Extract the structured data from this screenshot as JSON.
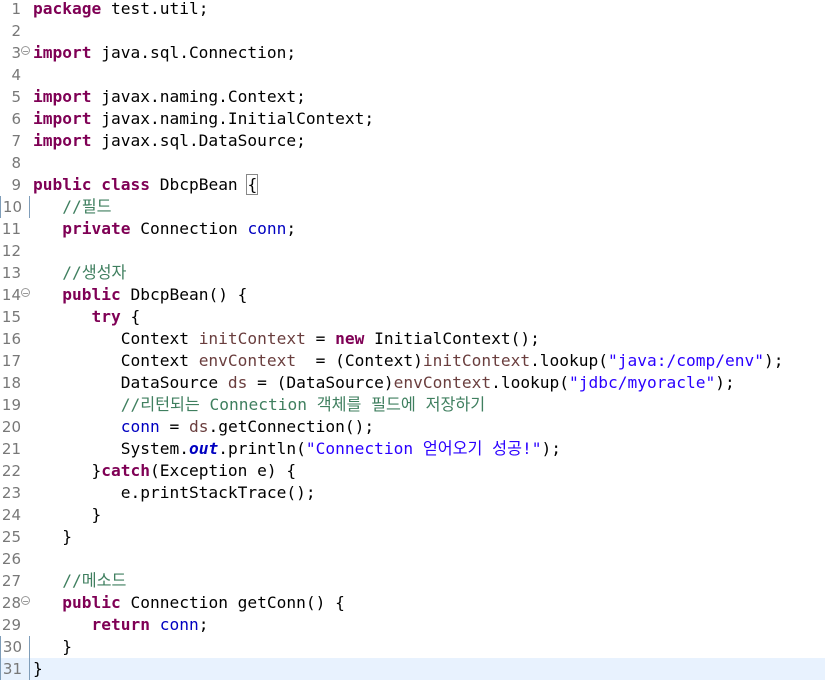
{
  "editor": {
    "tokens": {
      "package": "package",
      "pkg_name": " test.util;",
      "import": "import",
      "imp1": " java.sql.Connection;",
      "imp2": " javax.naming.Context;",
      "imp3": " javax.naming.InitialContext;",
      "imp4": " javax.sql.DataSource;",
      "public": "public",
      "class": "class",
      "private": "private",
      "try": "try",
      "new": "new",
      "catch": "catch",
      "return": "return",
      "sp": " ",
      "class_name": " DbcpBean ",
      "lbrace": "{",
      "rbrace": "}",
      "indent1": "   ",
      "indent2": "      ",
      "indent3": "         ",
      "c_field": "//필드",
      "field_type": " Connection ",
      "conn": "conn",
      "semi": ";",
      "c_ctor": "//생성자",
      "ctor_sig": " DbcpBean() {",
      "try_tail": " {",
      "l16_a": "Context ",
      "initContext": "initContext",
      "l16_b": " = ",
      "l16_c": " InitialContext();",
      "l17_a": "Context ",
      "envContext": "envContext",
      "l17_b": "  = (Context)",
      "l17_c": ".lookup(",
      "str_jndi": "\"java:/comp/env\"",
      "l17_d": ");",
      "l18_a": "DataSource ",
      "ds": "ds",
      "l18_b": " = (DataSource)",
      "str_pool": "\"jdbc/myoracle\"",
      "c_store": "//리턴되는 Connection 객체를 필드에 저장하기",
      "l20_b": " = ",
      "l20_c": ".getConnection();",
      "l21_a": "System.",
      "out": "out",
      "l21_b": ".println(",
      "str_ok": "\"Connection 얻어오기 성공!\"",
      "catch_head": "(Exception e) {",
      "print_trace": "e.printStackTrace();",
      "c_method": "//메소드",
      "method_sig": " Connection getConn() {"
    }
  }
}
